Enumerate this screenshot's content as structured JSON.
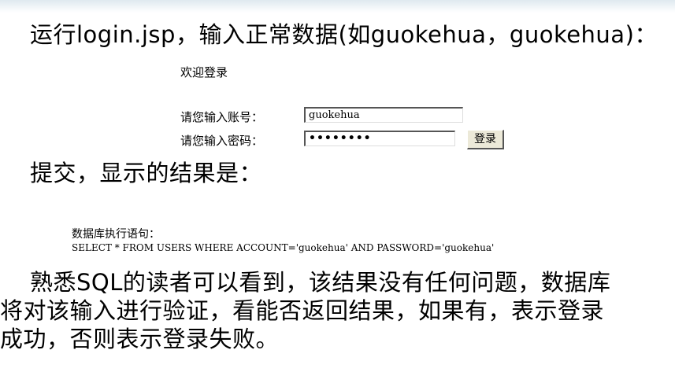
{
  "slide": {
    "line1": "运行login.jsp，输入正常数据(如guokehua，guokehua)：",
    "line2": "提交，显示的结果是：",
    "para_line1": "熟悉SQL的读者可以看到，该结果没有任何问题，数据库",
    "para_line2": "将对该输入进行验证，看能否返回结果，如果有，表示登录",
    "para_line3": "成功，否则表示登录失败。"
  },
  "login_form": {
    "welcome": "欢迎登录",
    "account_label": "请您输入账号：",
    "account_value": "guokehua",
    "password_label": "请您输入密码：",
    "password_value": "••••••••",
    "submit_label": "登录"
  },
  "result": {
    "heading": "数据库执行语句：",
    "sql": "SELECT * FROM USERS WHERE ACCOUNT='guokehua' AND PASSWORD='guokehua'"
  }
}
